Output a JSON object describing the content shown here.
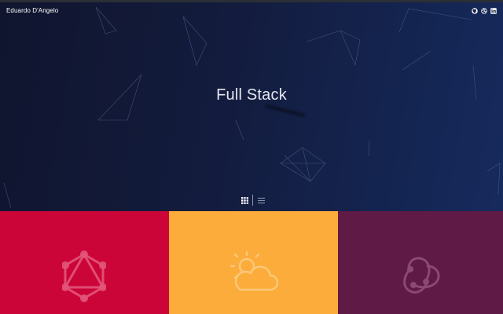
{
  "header": {
    "brand": "Eduardo D'Angelo",
    "social_icons": [
      "github-icon",
      "dribbble-icon",
      "linkedin-icon"
    ]
  },
  "hero": {
    "title": "Full Stack"
  },
  "view_toggle": {
    "options": [
      "grid-icon",
      "list-icon"
    ],
    "active": "grid-icon"
  },
  "tiles": [
    {
      "name": "graphql",
      "icon": "graphql-icon",
      "color": "#cc0538"
    },
    {
      "name": "weather",
      "icon": "weather-icon",
      "color": "#fbac3a"
    },
    {
      "name": "redux",
      "icon": "redux-icon",
      "color": "#5f1a45"
    }
  ],
  "colors": {
    "hero_background": "#131c3e",
    "text": "#ffffff"
  }
}
